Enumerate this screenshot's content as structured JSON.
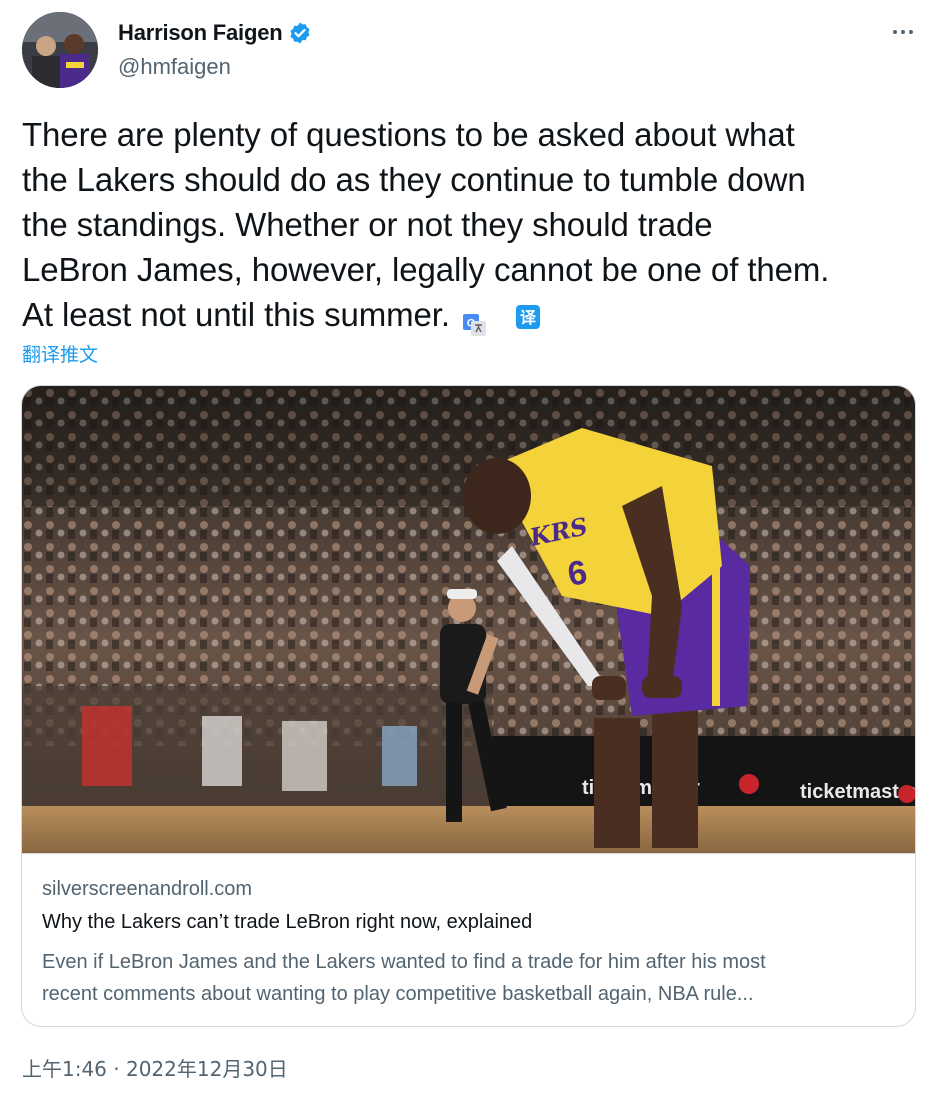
{
  "author": {
    "display_name": "Harrison Faigen",
    "handle": "@hmfaigen",
    "verified_icon": "verified-badge-icon",
    "more_icon": "more-options-icon"
  },
  "tweet": {
    "lines": [
      "There are plenty of questions to be asked about what",
      "the Lakers should do as they continue to tumble down",
      "the standings. Whether or not they should trade",
      "LeBron James, however, legally cannot be one of them.",
      "At least not until this summer."
    ],
    "translate_badge": "译",
    "translate_link": "翻译推文"
  },
  "card": {
    "jersey_text": "KRS",
    "jersey_number": "6",
    "courtside_ad": "ticketmaster",
    "domain": "silverscreenandroll.com",
    "title": "Why the Lakers can’t trade LeBron right now, explained",
    "description_lines": [
      "Even if LeBron James and the Lakers wanted to find a trade for him after his most",
      "recent comments about wanting to play competitive basketball again, NBA rule..."
    ]
  },
  "timestamp": "上午1:46 · 2022年12月30日",
  "colors": {
    "accent": "#1d9bf0",
    "text_primary": "#0f1419",
    "text_secondary": "#536471",
    "border": "#cfd9de",
    "lakers_gold": "#f3d23a",
    "lakers_purple": "#5a2ba0"
  }
}
